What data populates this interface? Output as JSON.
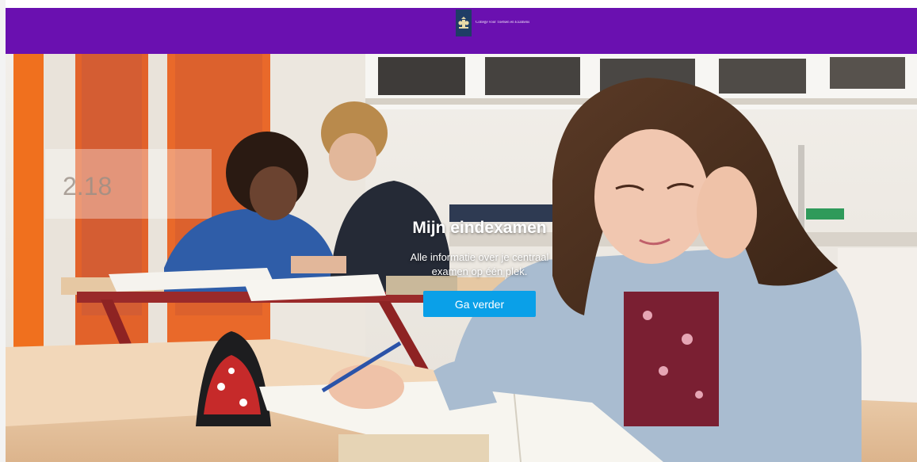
{
  "header": {
    "logo_icon": "rijksoverheid-emblem-icon",
    "logo_text": "College voor Toetsen en Examens",
    "background_color": "#6a10b0"
  },
  "hero": {
    "title": "Mijn eindexamen",
    "subtitle": "Alle informatie over je centraal examen op één plek.",
    "cta_label": "Ga verder",
    "cta_color": "#0aa0e8",
    "room_number": "2.18"
  }
}
